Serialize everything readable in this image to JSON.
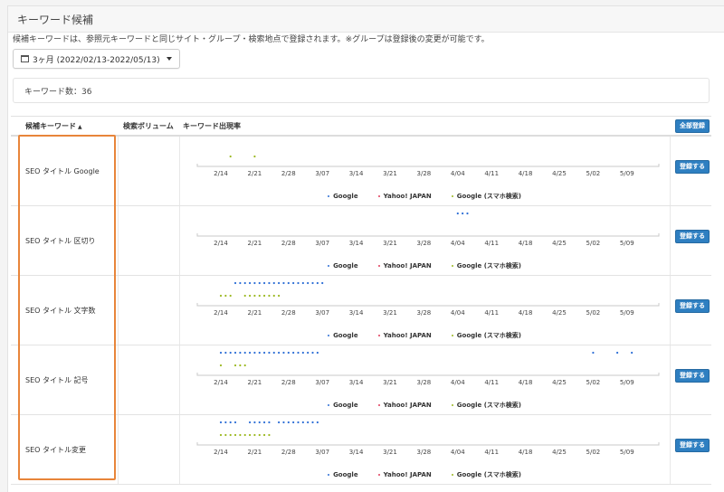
{
  "panel": {
    "title": "キーワード候補"
  },
  "description": "候補キーワードは、参照元キーワードと同じサイト・グループ・検索地点で登録されます。※グループは登録後の変更が可能です。",
  "date_range": "3ヶ月 (2022/02/13-2022/05/13)",
  "keyword_count": "キーワード数：36",
  "table": {
    "headers": {
      "keyword": "候補キーワード",
      "sort": "▲",
      "volume": "検索ボリューム",
      "rate": "キーワード出現率"
    },
    "register_all": "全部登録",
    "register": "登録する",
    "legend": [
      "Google",
      "Yahoo! JAPAN",
      "Google (スマホ検索)"
    ],
    "x_ticks": [
      "2/14",
      "2/21",
      "2/28",
      "3/07",
      "3/14",
      "3/21",
      "3/28",
      "4/04",
      "4/11",
      "4/18",
      "4/25",
      "5/02",
      "5/09"
    ],
    "rows": [
      {
        "keyword": "SEO タイトル Google",
        "google": [],
        "yahoo": [],
        "mobile": [
          31,
          36
        ]
      },
      {
        "keyword": "SEO タイトル 区切り",
        "google": [
          78,
          79,
          80
        ],
        "yahoo": [],
        "mobile": []
      },
      {
        "keyword": "SEO タイトル 文字数",
        "google": [
          32,
          33,
          34,
          35,
          36,
          37,
          38,
          39,
          40,
          41,
          42,
          43,
          44,
          45,
          46,
          47,
          48,
          49,
          50
        ],
        "yahoo": [],
        "mobile": [
          29,
          30,
          31,
          34,
          35,
          36,
          37,
          38,
          39,
          40,
          41
        ]
      },
      {
        "keyword": "SEO タイトル 記号",
        "google": [
          29,
          30,
          31,
          32,
          33,
          34,
          35,
          36,
          37,
          38,
          39,
          40,
          41,
          42,
          43,
          44,
          45,
          46,
          47,
          48,
          49,
          106,
          111,
          114
        ],
        "yahoo": [],
        "mobile": [
          29,
          32,
          33,
          34
        ]
      },
      {
        "keyword": "SEO タイトル変更",
        "google": [
          29,
          30,
          31,
          32,
          35,
          36,
          37,
          38,
          39,
          41,
          42,
          43,
          44,
          45,
          46,
          47,
          48,
          49
        ],
        "yahoo": [],
        "mobile": [
          29,
          30,
          31,
          32,
          33,
          34,
          35,
          36,
          37,
          38,
          39
        ]
      }
    ]
  },
  "colors": {
    "google": "#2e6fd6",
    "yahoo": "#e03c5a",
    "mobile": "#9bb81f",
    "accent": "#2e7fc1",
    "highlight": "#e8853a"
  }
}
